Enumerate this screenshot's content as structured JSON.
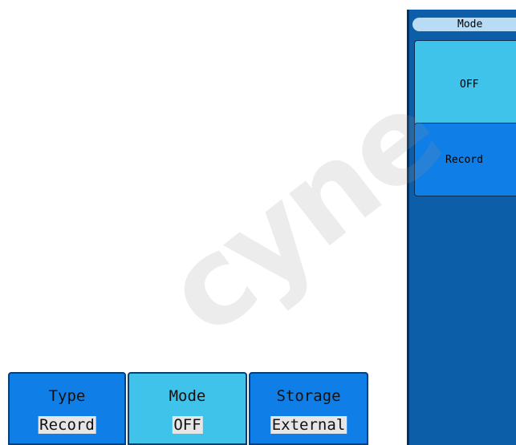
{
  "side_menu": {
    "title": "Mode",
    "items": [
      {
        "label": "OFF",
        "selected": true
      },
      {
        "label": "Record",
        "selected": false
      }
    ]
  },
  "bottom_menu": {
    "items": [
      {
        "label": "Type",
        "value": "Record",
        "selected": false
      },
      {
        "label": "Mode",
        "value": "OFF",
        "selected": true
      },
      {
        "label": "Storage",
        "value": "External",
        "selected": false
      }
    ]
  },
  "watermark": "cyne",
  "colors": {
    "panel_bg": "#0d5ea8",
    "button_blue": "#0f7ee6",
    "button_selected": "#3fc3ea",
    "title_bg": "#b9dcf4",
    "value_bg": "#e6e6e6"
  }
}
